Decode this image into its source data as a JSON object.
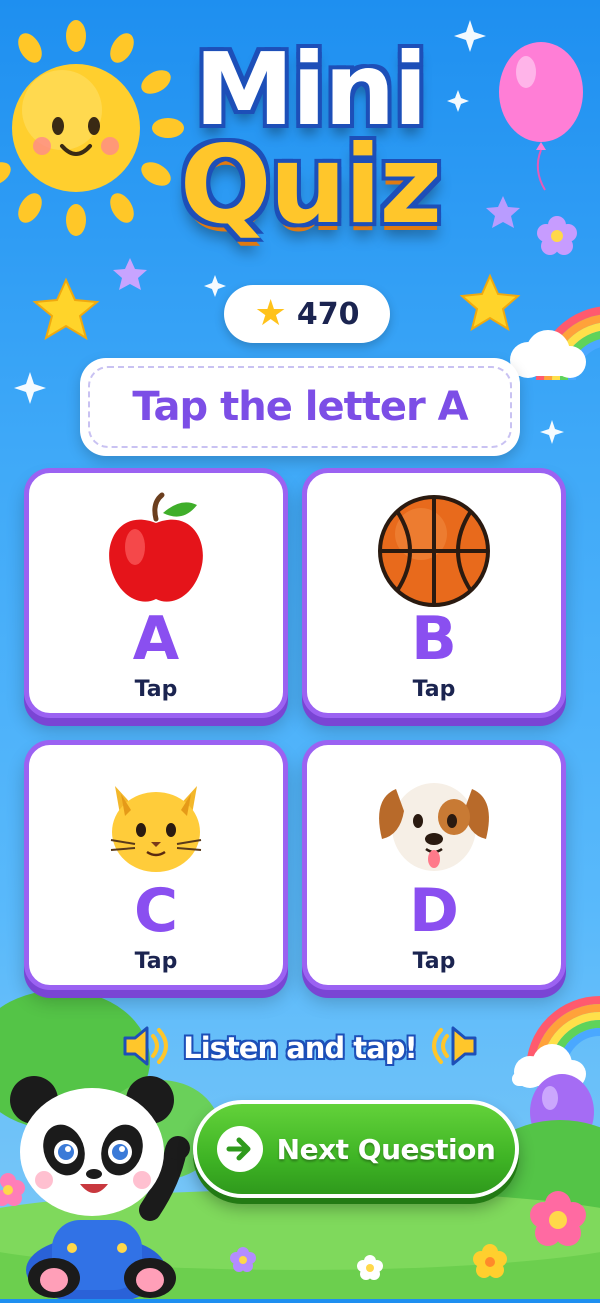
{
  "app": {
    "title_line1": "Mini",
    "title_line2": "Quiz"
  },
  "score": {
    "icon": "star-icon",
    "value": "470"
  },
  "prompt": {
    "text": "Tap the letter A"
  },
  "cards": [
    {
      "letter": "A",
      "tap_label": "Tap",
      "picture": "apple-icon"
    },
    {
      "letter": "B",
      "tap_label": "Tap",
      "picture": "basketball-icon"
    },
    {
      "letter": "C",
      "tap_label": "Tap",
      "picture": "cat-icon"
    },
    {
      "letter": "D",
      "tap_label": "Tap",
      "picture": "dog-icon"
    }
  ],
  "listen": {
    "text": "Listen and tap!",
    "icon": "speaker-icon"
  },
  "next_button": {
    "label": "Next Question",
    "icon": "arrow-right-icon"
  },
  "colors": {
    "accent_purple": "#8a4ff0",
    "button_green": "#3fb425",
    "title_yellow": "#ffc62b",
    "sky_blue": "#3fa9f8"
  }
}
